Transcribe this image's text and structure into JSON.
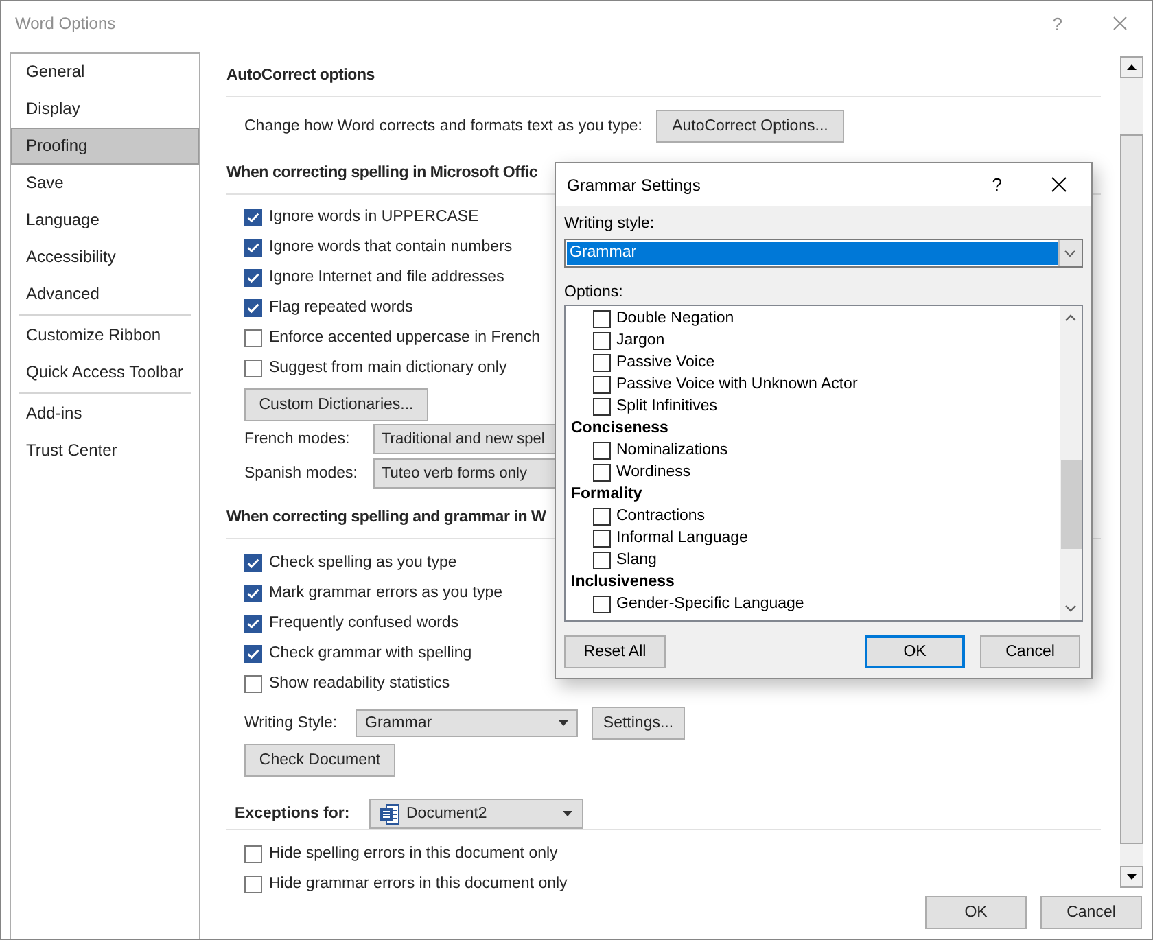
{
  "window": {
    "title": "Word Options",
    "help": "?"
  },
  "sidebar": {
    "groups": [
      {
        "items": [
          {
            "label": "General",
            "selected": false
          },
          {
            "label": "Display",
            "selected": false
          },
          {
            "label": "Proofing",
            "selected": true
          },
          {
            "label": "Save",
            "selected": false
          },
          {
            "label": "Language",
            "selected": false
          },
          {
            "label": "Accessibility",
            "selected": false
          },
          {
            "label": "Advanced",
            "selected": false
          }
        ]
      },
      {
        "items": [
          {
            "label": "Customize Ribbon",
            "selected": false
          },
          {
            "label": "Quick Access Toolbar",
            "selected": false
          }
        ]
      },
      {
        "items": [
          {
            "label": "Add-ins",
            "selected": false
          },
          {
            "label": "Trust Center",
            "selected": false
          }
        ]
      }
    ]
  },
  "autocorrect": {
    "heading": "AutoCorrect options",
    "description": "Change how Word corrects and formats text as you type:",
    "button": "AutoCorrect Options..."
  },
  "office_spelling": {
    "heading": "When correcting spelling in Microsoft Offic",
    "options": [
      {
        "label": "Ignore words in UPPERCASE",
        "checked": true
      },
      {
        "label": "Ignore words that contain numbers",
        "checked": true
      },
      {
        "label": "Ignore Internet and file addresses",
        "checked": true
      },
      {
        "label": "Flag repeated words",
        "checked": true
      },
      {
        "label": "Enforce accented uppercase in French",
        "checked": false
      },
      {
        "label": "Suggest from main dictionary only",
        "checked": false
      }
    ],
    "button": "Custom Dictionaries...",
    "modes": [
      {
        "label": "French modes:",
        "value": "Traditional and new spel"
      },
      {
        "label": "Spanish modes:",
        "value": "Tuteo verb forms only"
      }
    ]
  },
  "word_spelling": {
    "heading": "When correcting spelling and grammar in W",
    "options": [
      {
        "label": "Check spelling as you type",
        "checked": true
      },
      {
        "label": "Mark grammar errors as you type",
        "checked": true
      },
      {
        "label": "Frequently confused words",
        "checked": true
      },
      {
        "label": "Check grammar with spelling",
        "checked": true
      },
      {
        "label": "Show readability statistics",
        "checked": false
      }
    ],
    "writing_style": {
      "label": "Writing Style:",
      "value": "Grammar"
    },
    "settings_button": "Settings...",
    "check_button": "Check Document"
  },
  "exceptions": {
    "label": "Exceptions for:",
    "document": "Document2",
    "options": [
      {
        "label": "Hide spelling errors in this document only",
        "checked": false
      },
      {
        "label": "Hide grammar errors in this document only",
        "checked": false
      }
    ]
  },
  "footer": {
    "buttons": [
      "OK",
      "Cancel"
    ]
  },
  "grammar_dialog": {
    "title": "Grammar Settings",
    "help": "?",
    "writing_style": {
      "label": "Writing style:",
      "value": "Grammar",
      "focused": true
    },
    "options_label": "Options:",
    "options": [
      {
        "kind": "option",
        "label": "Double Negation",
        "checked": false
      },
      {
        "kind": "option",
        "label": "Jargon",
        "checked": false
      },
      {
        "kind": "option",
        "label": "Passive Voice",
        "checked": false
      },
      {
        "kind": "option",
        "label": "Passive Voice with Unknown Actor",
        "checked": false
      },
      {
        "kind": "option",
        "label": "Split Infinitives",
        "checked": false
      },
      {
        "kind": "group",
        "label": "Conciseness"
      },
      {
        "kind": "option",
        "label": "Nominalizations",
        "checked": false
      },
      {
        "kind": "option",
        "label": "Wordiness",
        "checked": false
      },
      {
        "kind": "group",
        "label": "Formality"
      },
      {
        "kind": "option",
        "label": "Contractions",
        "checked": false
      },
      {
        "kind": "option",
        "label": "Informal Language",
        "checked": false
      },
      {
        "kind": "option",
        "label": "Slang",
        "checked": false
      },
      {
        "kind": "group",
        "label": "Inclusiveness"
      },
      {
        "kind": "option",
        "label": "Gender-Specific Language",
        "checked": false
      }
    ],
    "buttons": [
      {
        "label": "Reset All",
        "default": false
      },
      {
        "label": "OK",
        "default": true
      },
      {
        "label": "Cancel",
        "default": false
      }
    ]
  }
}
